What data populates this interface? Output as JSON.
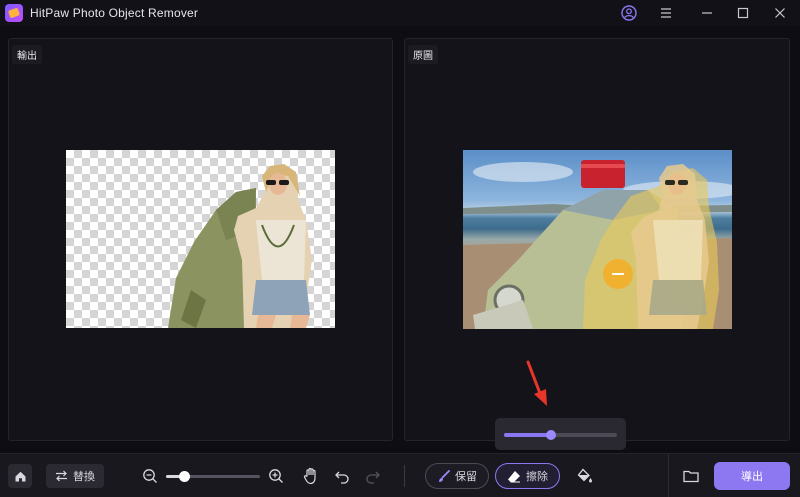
{
  "window": {
    "title": "HitPaw Photo Object Remover"
  },
  "panels": {
    "output_label": "輸出",
    "original_label": "原圖"
  },
  "brush_size": {
    "level": 0.42
  },
  "toolbar": {
    "replace_label": "替換",
    "zoom_level": 0.19,
    "keep_label": "保留",
    "erase_label": "擦除",
    "export_label": "導出"
  },
  "colors": {
    "accent": "#8d78f2",
    "brush_cursor": "#f2b02d",
    "annotation_arrow": "#e8352a"
  },
  "icons": {
    "home": "home-icon",
    "replace": "swap-arrows-icon",
    "zoom_out": "zoom-out-icon",
    "zoom_in": "zoom-in-icon",
    "hand": "hand-icon",
    "undo": "undo-icon",
    "redo": "redo-icon",
    "keep": "brush-icon",
    "erase": "eraser-icon",
    "fill": "paint-bucket-icon",
    "folder": "folder-icon",
    "account": "account-icon",
    "menu": "menu-icon"
  }
}
